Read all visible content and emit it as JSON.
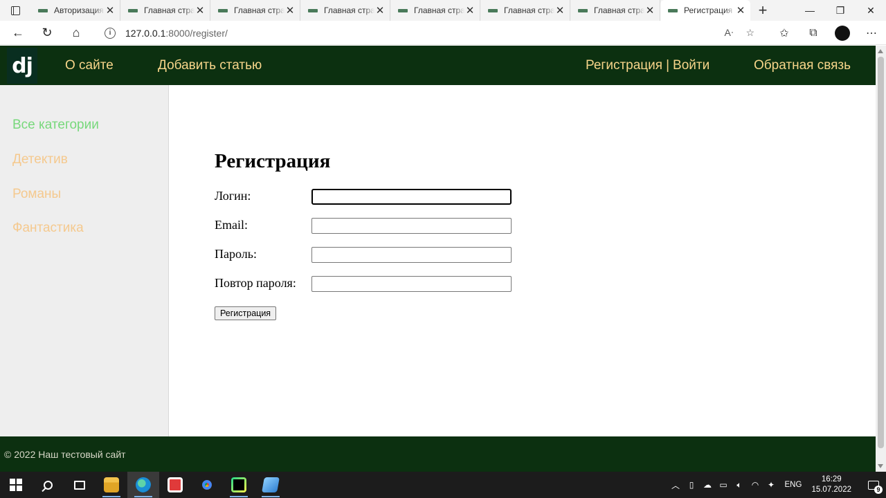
{
  "browser": {
    "tabs": [
      {
        "title": "Авторизация",
        "active": false
      },
      {
        "title": "Главная стра",
        "active": false
      },
      {
        "title": "Главная стра",
        "active": false
      },
      {
        "title": "Главная стра",
        "active": false
      },
      {
        "title": "Главная стра",
        "active": false
      },
      {
        "title": "Главная стра",
        "active": false
      },
      {
        "title": "Главная стра",
        "active": false
      },
      {
        "title": "Регистрация",
        "active": true
      }
    ],
    "url_host": "127.0.0.1",
    "url_rest": ":8000/register/"
  },
  "site": {
    "logo": "dj",
    "nav": {
      "about": "О сайте",
      "add_article": "Добавить статью",
      "register": "Регистрация",
      "separator": "|",
      "login": "Войти",
      "feedback": "Обратная связь"
    },
    "categories": [
      {
        "label": "Все категории",
        "active": true
      },
      {
        "label": "Детектив",
        "active": false
      },
      {
        "label": "Романы",
        "active": false
      },
      {
        "label": "Фантастика",
        "active": false
      }
    ],
    "form": {
      "heading": "Регистрация",
      "fields": [
        {
          "label": "Логин:",
          "value": ""
        },
        {
          "label": "Email:",
          "value": ""
        },
        {
          "label": "Пароль:",
          "value": ""
        },
        {
          "label": "Повтор пароля:",
          "value": ""
        }
      ],
      "submit_label": "Регистрация"
    },
    "footer": "© 2022 Наш тестовый сайт"
  },
  "taskbar": {
    "lang": "ENG",
    "time": "16:29",
    "date": "15.07.2022",
    "notifications": "9"
  },
  "colors": {
    "header_bg": "#0c3010",
    "nav_link": "#f7d58a",
    "category_link": "#f5c98e",
    "category_active": "#77d87b"
  }
}
